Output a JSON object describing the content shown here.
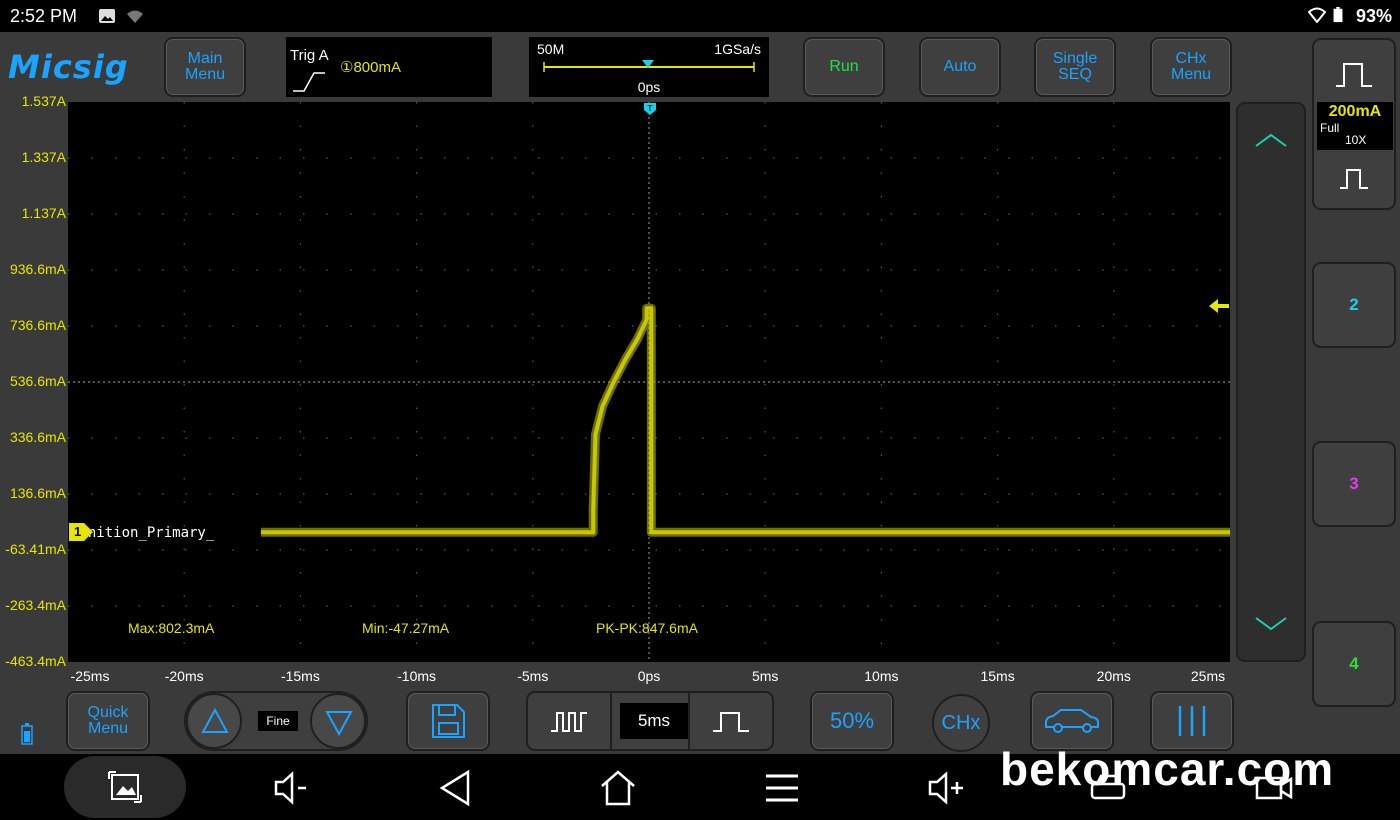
{
  "status_bar": {
    "time": "2:52 PM",
    "battery": "93%"
  },
  "app": {
    "logo": "Micsig",
    "buttons": {
      "main_menu": "Main\nMenu",
      "run": "Run",
      "auto": "Auto",
      "single_seq": "Single\nSEQ",
      "chx_menu": "CHx\nMenu",
      "quick_menu": "Quick\nMenu",
      "fine": "Fine",
      "timebase": "5ms",
      "fifty": "50%",
      "chx": "CHx"
    },
    "trigger": {
      "label": "Trig A",
      "level": "①800mA"
    },
    "timebase_info": {
      "memory": "50M",
      "sample_rate": "1GSa/s",
      "delay": "0ps"
    },
    "channel1": {
      "scale": "200mA",
      "coupling": "Full",
      "probe": "10X",
      "marker": "1",
      "trace_name": "Ignition_Primary_"
    },
    "channel_buttons": [
      "2",
      "3",
      "4"
    ],
    "colors": {
      "ch1": "#c8c800",
      "ch2": "#1ad0e8",
      "ch3": "#e040e0",
      "ch4": "#30e030",
      "accent": "#1aa3ff"
    }
  },
  "chart_data": {
    "type": "line",
    "xlabel": "",
    "ylabel": "",
    "x_tick_labels": [
      "-25ms",
      "-20ms",
      "-15ms",
      "-10ms",
      "-5ms",
      "0ps",
      "5ms",
      "10ms",
      "15ms",
      "20ms",
      "25ms"
    ],
    "y_tick_labels": [
      "1.537A",
      "1.337A",
      "1.137A",
      "936.6mA",
      "736.6mA",
      "536.6mA",
      "336.6mA",
      "136.6mA",
      "-63.41mA",
      "-263.4mA",
      "-463.4mA"
    ],
    "xlim": [
      -25,
      25
    ],
    "ylim": [
      -463.4,
      1537
    ],
    "grid": true,
    "series": [
      {
        "name": "Ignition_Primary_",
        "x": [
          -16.7,
          -2.4,
          -2.4,
          -2.3,
          -2.0,
          -1.5,
          -1.0,
          -0.5,
          -0.1,
          -0.1,
          0.1,
          0.1,
          25
        ],
        "y": [
          0,
          0,
          80,
          350,
          450,
          540,
          620,
          690,
          760,
          800,
          800,
          0,
          0
        ]
      }
    ],
    "measurements": {
      "max": "Max:802.3mA",
      "min": "Min:-47.27mA",
      "pk_pk": "PK-PK:847.6mA"
    }
  },
  "watermark": "bekomcar.com"
}
